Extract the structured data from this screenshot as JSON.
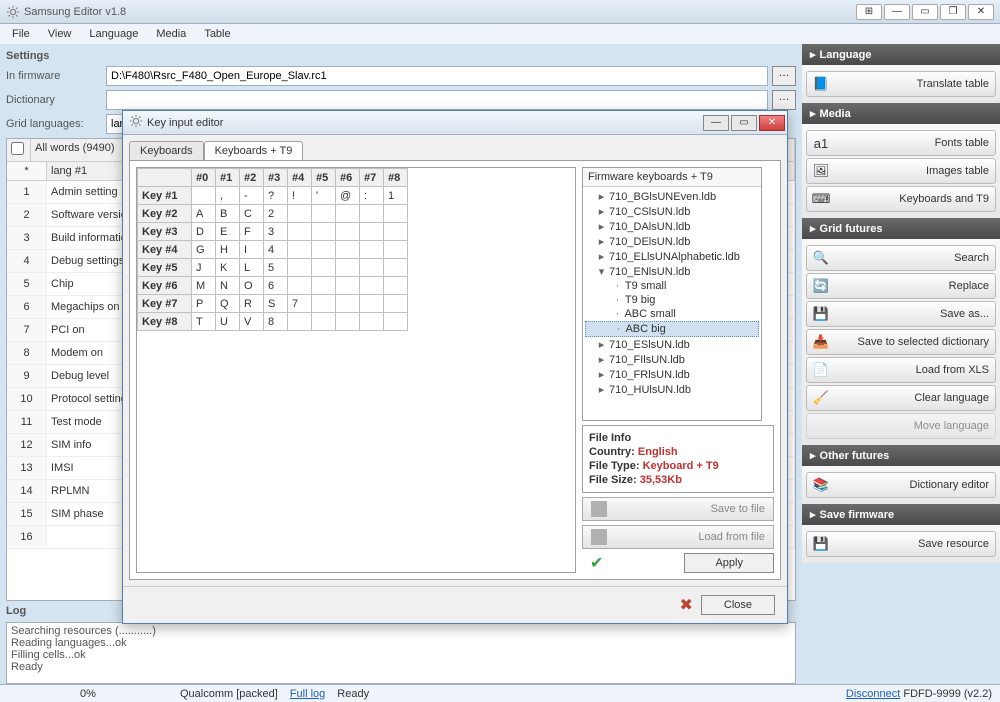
{
  "app": {
    "title": "Samsung Editor v1.8"
  },
  "menu": [
    "File",
    "View",
    "Language",
    "Media",
    "Table"
  ],
  "settings": {
    "title": "Settings",
    "firmware_label": "In firmware",
    "firmware_value": "D:\\F480\\Rsrc_F480_Open_Europe_Slav.rc1",
    "dictionary_label": "Dictionary",
    "dictionary_value": "",
    "grid_lang_label": "Grid languages:",
    "grid_lang_value": "lar"
  },
  "grid": {
    "header_all": "All words (9490)",
    "col_blank": "*",
    "col_lang": "lang #1",
    "rows": [
      {
        "n": "1",
        "v": "Admin setting"
      },
      {
        "n": "2",
        "v": "Software versio"
      },
      {
        "n": "3",
        "v": "Build information"
      },
      {
        "n": "4",
        "v": "Debug settings"
      },
      {
        "n": "5",
        "v": "Chip"
      },
      {
        "n": "6",
        "v": "Megachips on"
      },
      {
        "n": "7",
        "v": "PCI on"
      },
      {
        "n": "8",
        "v": "Modem on"
      },
      {
        "n": "9",
        "v": "Debug level"
      },
      {
        "n": "10",
        "v": "Protocol settings"
      },
      {
        "n": "11",
        "v": "Test mode"
      },
      {
        "n": "12",
        "v": "SIM info"
      },
      {
        "n": "13",
        "v": "IMSI"
      },
      {
        "n": "14",
        "v": "RPLMN"
      },
      {
        "n": "15",
        "v": "SIM phase"
      },
      {
        "n": "16",
        "v": ""
      }
    ]
  },
  "log": {
    "label": "Log",
    "lines": [
      "Searching resources (...........)",
      "Reading languages...ok",
      "Filling cells...ok",
      "Ready"
    ]
  },
  "panels": {
    "language": {
      "title": "Language",
      "buttons": [
        {
          "icon": "📘",
          "label": "Translate table"
        }
      ]
    },
    "media": {
      "title": "Media",
      "buttons": [
        {
          "icon": "a1",
          "label": "Fonts table"
        },
        {
          "icon": "🖼",
          "label": "Images table"
        },
        {
          "icon": "⌨",
          "label": "Keyboards and T9"
        }
      ]
    },
    "gridfutures": {
      "title": "Grid futures",
      "buttons": [
        {
          "icon": "🔍",
          "label": "Search"
        },
        {
          "icon": "🔄",
          "label": "Replace"
        },
        {
          "icon": "💾",
          "label": "Save as..."
        },
        {
          "icon": "📥",
          "label": "Save to selected dictionary"
        },
        {
          "icon": "📄",
          "label": "Load from XLS"
        },
        {
          "icon": "🧹",
          "label": "Clear language"
        },
        {
          "icon": "",
          "label": "Move language",
          "disabled": true
        }
      ]
    },
    "other": {
      "title": "Other futures",
      "buttons": [
        {
          "icon": "📚",
          "label": "Dictionary editor"
        }
      ]
    },
    "save": {
      "title": "Save firmware",
      "buttons": [
        {
          "icon": "💾",
          "label": "Save resource"
        }
      ]
    }
  },
  "status": {
    "pct": "0%",
    "mode": "Qualcomm [packed]",
    "full_log": "Full log",
    "ready": "Ready",
    "disconnect": "Disconnect",
    "device": "FDFD-9999 (v2.2)"
  },
  "modal": {
    "title": "Key input editor",
    "tabs": [
      "Keyboards",
      "Keyboards + T9"
    ],
    "active_tab": 1,
    "grid_cols": [
      "#0",
      "#1",
      "#2",
      "#3",
      "#4",
      "#5",
      "#6",
      "#7",
      "#8"
    ],
    "grid_rows": [
      {
        "h": "Key #1",
        "c": [
          "",
          ",",
          "-",
          "?",
          "!",
          "'",
          "@",
          ":",
          "1"
        ]
      },
      {
        "h": "Key #2",
        "c": [
          "A",
          "B",
          "C",
          "2",
          "",
          "",
          "",
          "",
          ""
        ]
      },
      {
        "h": "Key #3",
        "c": [
          "D",
          "E",
          "F",
          "3",
          "",
          "",
          "",
          "",
          ""
        ]
      },
      {
        "h": "Key #4",
        "c": [
          "G",
          "H",
          "I",
          "4",
          "",
          "",
          "",
          "",
          ""
        ]
      },
      {
        "h": "Key #5",
        "c": [
          "J",
          "K",
          "L",
          "5",
          "",
          "",
          "",
          "",
          ""
        ]
      },
      {
        "h": "Key #6",
        "c": [
          "M",
          "N",
          "O",
          "6",
          "",
          "",
          "",
          "",
          ""
        ]
      },
      {
        "h": "Key #7",
        "c": [
          "P",
          "Q",
          "R",
          "S",
          "7",
          "",
          "",
          "",
          ""
        ]
      },
      {
        "h": "Key #8",
        "c": [
          "T",
          "U",
          "V",
          "8",
          "",
          "",
          "",
          "",
          ""
        ]
      }
    ],
    "tree_header": "Firmware keyboards + T9",
    "tree": [
      {
        "t": "collapsed",
        "label": "710_BGlsUNEven.ldb"
      },
      {
        "t": "collapsed",
        "label": "710_CSlsUN.ldb"
      },
      {
        "t": "collapsed",
        "label": "710_DAlsUN.ldb"
      },
      {
        "t": "collapsed",
        "label": "710_DElsUN.ldb"
      },
      {
        "t": "collapsed",
        "label": "710_ELlsUNAlphabetic.ldb"
      },
      {
        "t": "expanded",
        "label": "710_ENlsUN.ldb"
      },
      {
        "t": "child",
        "label": "T9 small"
      },
      {
        "t": "child",
        "label": "T9 big"
      },
      {
        "t": "child",
        "label": "ABC small"
      },
      {
        "t": "child selected",
        "label": "ABC big"
      },
      {
        "t": "collapsed",
        "label": "710_ESlsUN.ldb"
      },
      {
        "t": "collapsed",
        "label": "710_FIlsUN.ldb"
      },
      {
        "t": "collapsed",
        "label": "710_FRlsUN.ldb"
      },
      {
        "t": "collapsed",
        "label": "710_HUlsUN.ldb"
      }
    ],
    "file_info": {
      "title": "File Info",
      "country_label": "Country:",
      "country": "English",
      "type_label": "File Type:",
      "type": "Keyboard + T9",
      "size_label": "File Size:",
      "size": "35,53Kb"
    },
    "action_save": "Save to file",
    "action_load": "Load from file",
    "apply": "Apply",
    "close": "Close"
  }
}
